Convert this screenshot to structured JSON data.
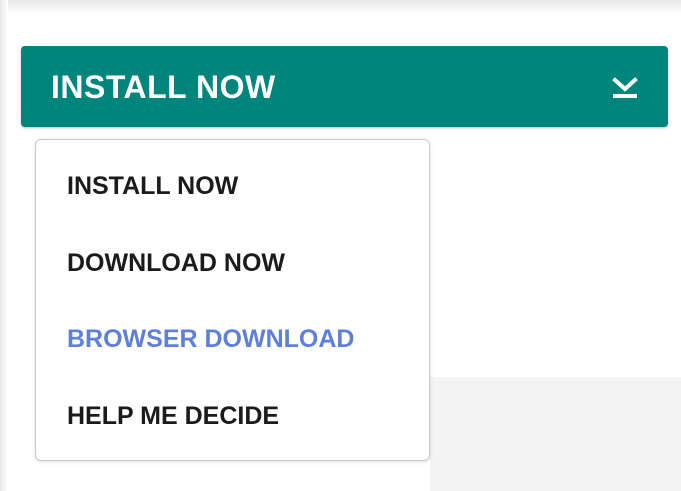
{
  "install_button": {
    "label": "INSTALL NOW",
    "icon": "download-icon",
    "background_color": "#00857d"
  },
  "dropdown": {
    "items": [
      {
        "label": "INSTALL NOW",
        "highlighted": false
      },
      {
        "label": "DOWNLOAD NOW",
        "highlighted": false
      },
      {
        "label": "BROWSER DOWNLOAD",
        "highlighted": true,
        "color": "#5f7fdc"
      },
      {
        "label": "HELP ME DECIDE",
        "highlighted": false
      }
    ]
  }
}
